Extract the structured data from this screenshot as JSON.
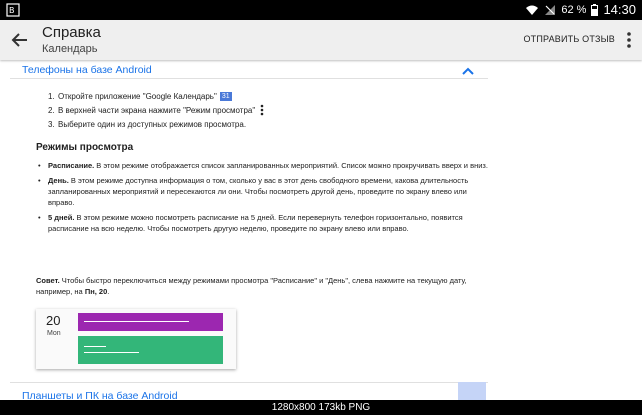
{
  "status_bar": {
    "battery": "62 %",
    "time": "14:30"
  },
  "app_bar": {
    "title": "Справка",
    "subtitle": "Календарь",
    "feedback": "ОТПРАВИТЬ ОТЗЫВ"
  },
  "article": {
    "section_title": "Телефоны на базе Android",
    "steps": [
      {
        "num": "1.",
        "text": "Откройте приложение \"Google Календарь\"",
        "badge": "31"
      },
      {
        "num": "2.",
        "text": "В верхней части экрана нажмите \"Режим просмотра\""
      },
      {
        "num": "3.",
        "text": "Выберите один из доступных режимов просмотра."
      }
    ],
    "modes_title": "Режимы просмотра",
    "modes": [
      {
        "term": "Расписание.",
        "text": " В этом режиме отображается список запланированных мероприятий. Список можно прокручивать вверх и вниз."
      },
      {
        "term": "День.",
        "text": " В этом режиме доступна информация о том, сколько у вас в этот день свободного времени, какова длительность запланированных мероприятий и пересекаются ли они. Чтобы посмотреть другой день, проведите по экрану влево или вправо."
      },
      {
        "term": "5 дней.",
        "text": " В этом режиме можно посмотреть расписание на 5 дней. Если перевернуть телефон горизонтально, появится расписание на всю неделю. Чтобы посмотреть другую неделю, проведите по экрану влево или вправо."
      }
    ],
    "tip_label": "Совет.",
    "tip_text": " Чтобы быстро переключиться между режимами просмотра \"Расписание\" и \"День\", слева нажмите на текущую дату, например, на ",
    "tip_example": "Пн, 20",
    "tip_end": ".",
    "illustration": {
      "day": "20",
      "weekday": "Mon"
    },
    "next_section": "Планшеты и ПК на базе Android"
  },
  "caption": "1280x800  173kb  PNG",
  "colors": {
    "link": "#1a73e8",
    "event_purple": "#9c27b0",
    "event_green": "#33b679"
  }
}
